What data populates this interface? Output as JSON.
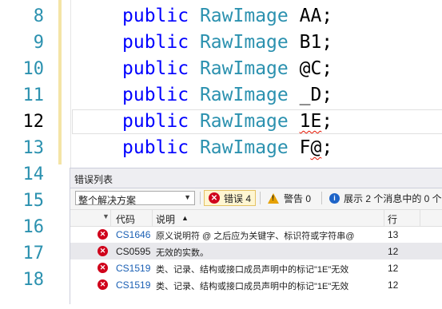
{
  "editor": {
    "line_numbers": [
      "8",
      "9",
      "10",
      "11",
      "12",
      "13",
      "14",
      "15",
      "16",
      "17",
      "18"
    ],
    "current_line": "12",
    "lines": [
      {
        "kw": "public",
        "type": "RawImage",
        "name": "AA",
        "semi": ";"
      },
      {
        "kw": "public",
        "type": "RawImage",
        "name": "B1",
        "semi": ";"
      },
      {
        "kw": "public",
        "type": "RawImage",
        "name": "@C",
        "semi": ";"
      },
      {
        "kw": "public",
        "type": "RawImage",
        "name": "_D",
        "semi": ";"
      },
      {
        "kw": "public",
        "type": "RawImage",
        "name": "1E",
        "semi": ";"
      },
      {
        "kw": "public",
        "type": "RawImage",
        "name_a": "F",
        "name_b": "@",
        "semi": ";"
      }
    ]
  },
  "error_list": {
    "title": "错误列表",
    "scope": "整个解决方案",
    "errors_button": "错误 4",
    "warnings_button": "警告 0",
    "messages_button": "展示 2 个消息中的 0 个",
    "columns": {
      "code": "代码",
      "description": "说明",
      "sort_arrow": "▲",
      "line": "行"
    },
    "rows": [
      {
        "code": "CS1646",
        "description": "原义说明符 @ 之后应为关键字、标识符或字符串@",
        "line": "13"
      },
      {
        "code": "CS0595",
        "description": "无效的实数。",
        "line": "12"
      },
      {
        "code": "CS1519",
        "description": "类、记录、结构或接口成员声明中的标记\"1E\"无效",
        "line": "12"
      },
      {
        "code": "CS1519",
        "description": "类、记录、结构或接口成员声明中的标记\"1E\"无效",
        "line": "12"
      }
    ]
  },
  "colors": {
    "keyword": "#0000ff",
    "type": "#2b91af",
    "error": "#d0021b",
    "squiggle": "#e51400"
  }
}
